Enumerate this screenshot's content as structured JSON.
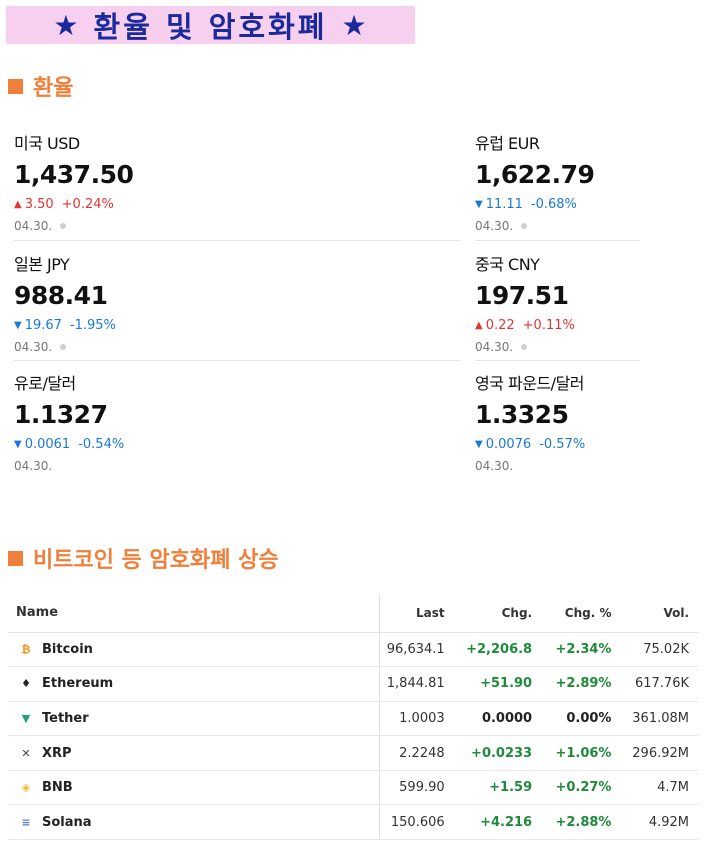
{
  "banner": {
    "star_left": "★",
    "title": "환율 및 암호화폐",
    "star_right": "★"
  },
  "fx_section": {
    "heading": "환율"
  },
  "fx": [
    {
      "name": "미국 USD",
      "value": "1,437.50",
      "direction": "up",
      "arrow": "▲",
      "change": "3.50",
      "pct": "+0.24%",
      "date": "04.30."
    },
    {
      "name": "유럽 EUR",
      "value": "1,622.79",
      "direction": "down",
      "arrow": "▼",
      "change": "11.11",
      "pct": "-0.68%",
      "date": "04.30."
    },
    {
      "name": "일본 JPY",
      "value": "988.41",
      "direction": "down",
      "arrow": "▼",
      "change": "19.67",
      "pct": "-1.95%",
      "date": "04.30."
    },
    {
      "name": "중국 CNY",
      "value": "197.51",
      "direction": "up",
      "arrow": "▲",
      "change": "0.22",
      "pct": "+0.11%",
      "date": "04.30."
    },
    {
      "name": "유로/달러",
      "value": "1.1327",
      "direction": "down",
      "arrow": "▼",
      "change": "0.0061",
      "pct": "-0.54%",
      "date": "04.30."
    },
    {
      "name": "영국 파운드/달러",
      "value": "1.3325",
      "direction": "down",
      "arrow": "▼",
      "change": "0.0076",
      "pct": "-0.57%",
      "date": "04.30."
    }
  ],
  "crypto_section": {
    "heading": "비트코인 등 암호화폐 상승"
  },
  "crypto_table": {
    "headers": {
      "name": "Name",
      "last": "Last",
      "chg": "Chg.",
      "chg_pct": "Chg. %",
      "vol": "Vol."
    },
    "rows": [
      {
        "icon": "bitcoin-icon",
        "glyph": "₿",
        "color": "#f7931a",
        "name": "Bitcoin",
        "last": "96,634.1",
        "chg": "+2,206.8",
        "pct": "+2.34%",
        "vol": "75.02K",
        "trend": "pos"
      },
      {
        "icon": "ethereum-icon",
        "glyph": "♦",
        "color": "#222222",
        "name": "Ethereum",
        "last": "1,844.81",
        "chg": "+51.90",
        "pct": "+2.89%",
        "vol": "617.76K",
        "trend": "pos"
      },
      {
        "icon": "tether-icon",
        "glyph": "▼",
        "color": "#26a17b",
        "name": "Tether",
        "last": "1.0003",
        "chg": "0.0000",
        "pct": "0.00%",
        "vol": "361.08M",
        "trend": "zero"
      },
      {
        "icon": "xrp-icon",
        "glyph": "✕",
        "color": "#444444",
        "name": "XRP",
        "last": "2.2248",
        "chg": "+0.0233",
        "pct": "+1.06%",
        "vol": "296.92M",
        "trend": "pos"
      },
      {
        "icon": "bnb-icon",
        "glyph": "◈",
        "color": "#f3ba2f",
        "name": "BNB",
        "last": "599.90",
        "chg": "+1.59",
        "pct": "+0.27%",
        "vol": "4.7M",
        "trend": "pos"
      },
      {
        "icon": "solana-icon",
        "glyph": "≡",
        "color": "#5a7bd8",
        "name": "Solana",
        "last": "150.606",
        "chg": "+4.216",
        "pct": "+2.88%",
        "vol": "4.92M",
        "trend": "pos"
      }
    ]
  }
}
